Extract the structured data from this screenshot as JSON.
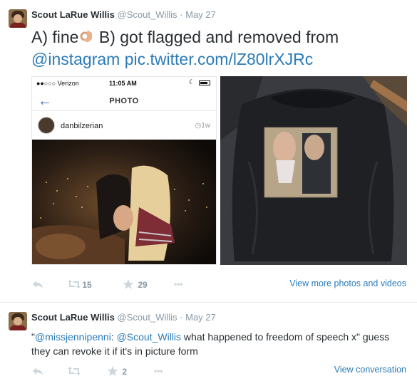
{
  "tweet1": {
    "name": "Scout LaRue Willis",
    "handle": "@Scout_Willis",
    "separator": "·",
    "date": "May 27",
    "text_part1": "A) fine",
    "text_part2": " B) got flagged and removed from",
    "mention": "@instagram",
    "pic_link": "pic.twitter.com/lZ80lrXJRc",
    "screenshot": {
      "carrier": "●●○○○ Verizon",
      "time": "11:05 AM",
      "back_label": "←",
      "title": "PHOTO",
      "username": "danbilzerian",
      "age": "◷1w"
    },
    "retweet_count": "15",
    "favorite_count": "29",
    "more_label": "•••",
    "view_more": "View more photos and videos"
  },
  "tweet2": {
    "name": "Scout LaRue Willis",
    "handle": "@Scout_Willis",
    "separator": "·",
    "date": "May 27",
    "quote_open": "\"",
    "mention1": "@missjennipenni",
    "colon": ": ",
    "mention2": "@Scout_Willis",
    "text_rest": " what happened to freedom of speech x\" guess they can revoke it if it's in picture form",
    "favorite_count": "2",
    "more_label": "•••",
    "view_conversation": "View conversation"
  },
  "colors": {
    "link": "#2b7bb9",
    "muted": "#8899a6",
    "text": "#292f33"
  },
  "icons": [
    "reply-icon",
    "retweet-icon",
    "favorite-icon",
    "more-icon",
    "ok-hand-emoji-icon",
    "back-arrow-icon",
    "battery-icon"
  ]
}
